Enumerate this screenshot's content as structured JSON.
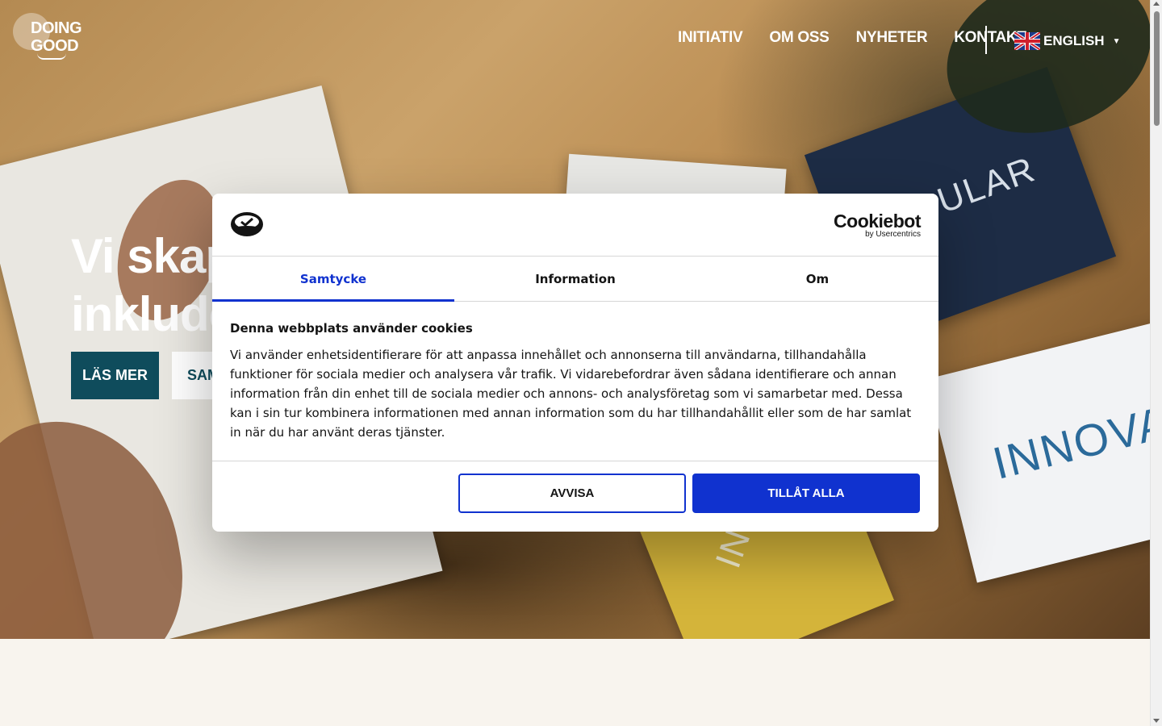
{
  "site": {
    "logo_text_line1": "DOING",
    "logo_text_line2": "GOOD"
  },
  "nav": {
    "items": [
      {
        "label": "INITIATIV"
      },
      {
        "label": "OM OSS"
      },
      {
        "label": "NYHETER"
      },
      {
        "label": "KONTAKT"
      }
    ],
    "language": {
      "label": "ENGLISH",
      "flag": "uk-flag-icon"
    }
  },
  "hero": {
    "title_line1": "Vi skapa",
    "title_line2": "inkluder",
    "primary_button": "LÄS MER",
    "secondary_button": "SAM",
    "background_words": [
      "INNOVAT",
      "ULAR",
      "INK"
    ]
  },
  "cookie_dialog": {
    "brand_name": "Cookiebot",
    "brand_sub": "by Usercentrics",
    "tabs": [
      {
        "label": "Samtycke",
        "active": true
      },
      {
        "label": "Information",
        "active": false
      },
      {
        "label": "Om",
        "active": false
      }
    ],
    "heading": "Denna webbplats använder cookies",
    "body": "Vi använder enhetsidentifierare för att anpassa innehållet och annonserna till användarna, tillhandahålla funktioner för sociala medier och analysera vår trafik. Vi vidarebefordrar även sådana identifierare och annan information från din enhet till de sociala medier och annons- och analysföretag som vi samarbetar med. Dessa kan i sin tur kombinera informationen med annan information som du har tillhandahållit eller som de har samlat in när du har använt deras tjänster.",
    "deny_button": "AVVISA",
    "allow_button": "TILLÅT ALLA",
    "accent_color": "#1032cf"
  },
  "colors": {
    "primary_button_bg": "#0f4c5c",
    "page_bg": "#f8f4ee"
  }
}
